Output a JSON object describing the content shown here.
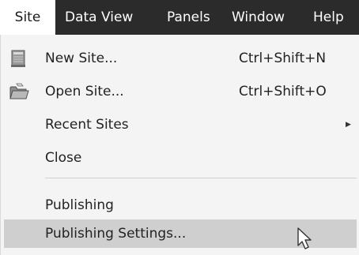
{
  "menubar": {
    "items": [
      {
        "label": "Site",
        "active": true
      },
      {
        "label": "Data View",
        "active": false
      },
      {
        "label": "Panels",
        "active": false
      },
      {
        "label": "Window",
        "active": false
      },
      {
        "label": "Help",
        "active": false
      }
    ]
  },
  "site_menu": {
    "items": [
      {
        "label": "New Site...",
        "shortcut": "Ctrl+Shift+N",
        "icon": "new-site-icon"
      },
      {
        "label": "Open Site...",
        "shortcut": "Ctrl+Shift+O",
        "icon": "open-folder-icon"
      },
      {
        "label": "Recent Sites",
        "submenu": true,
        "submenu_indicator": "▶"
      },
      {
        "label": "Close"
      },
      {
        "label": "Publishing"
      },
      {
        "label": "Publishing Settings...",
        "highlighted": true
      }
    ]
  },
  "colors": {
    "menubar_bg": "#2b2b2b",
    "menu_bg": "#f4f4f4",
    "highlight_bg": "#cfcfcf",
    "text": "#222222"
  }
}
